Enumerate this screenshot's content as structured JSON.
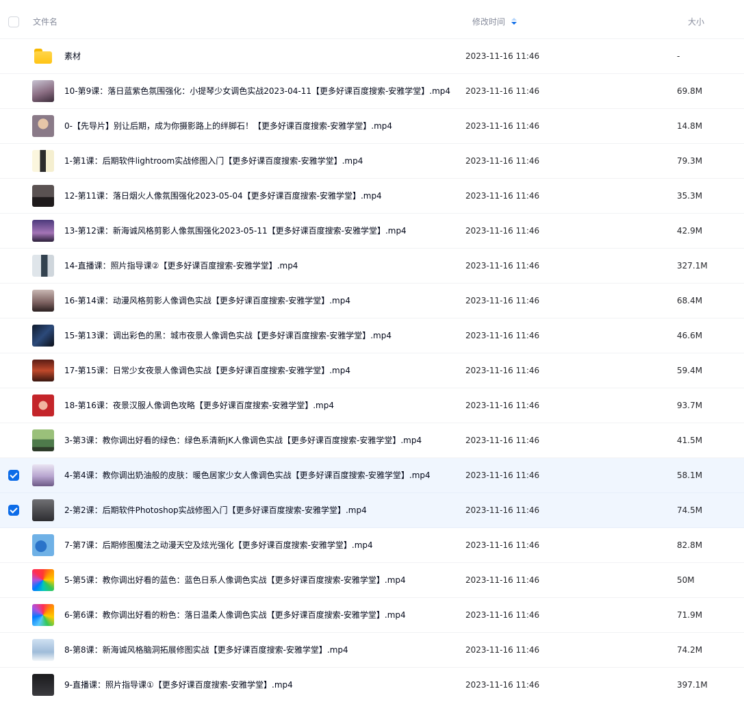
{
  "header": {
    "name_label": "文件名",
    "time_label": "修改时间",
    "size_label": "大小"
  },
  "files": [
    {
      "name": "素材",
      "time": "2023-11-16 11:46",
      "size": "-",
      "thumb": "folder-icon",
      "selected": false
    },
    {
      "name": "10-第9课：落日蓝紫色氛围强化：小提琴少女调色实战2023-04-11【更多好课百度搜索-安雅学堂】.mp4",
      "time": "2023-11-16 11:46",
      "size": "69.8M",
      "thumb": "video-thumbnail",
      "selected": false
    },
    {
      "name": "0-【先导片】别让后期，成为你摄影路上的绊脚石！【更多好课百度搜索-安雅学堂】.mp4",
      "time": "2023-11-16 11:46",
      "size": "14.8M",
      "thumb": "video-thumbnail",
      "selected": false
    },
    {
      "name": "1-第1课：后期软件lightroom实战修图入门【更多好课百度搜索-安雅学堂】.mp4",
      "time": "2023-11-16 11:46",
      "size": "79.3M",
      "thumb": "video-thumbnail",
      "selected": false
    },
    {
      "name": "12-第11课：落日烟火人像氛围强化2023-05-04【更多好课百度搜索-安雅学堂】.mp4",
      "time": "2023-11-16 11:46",
      "size": "35.3M",
      "thumb": "video-thumbnail",
      "selected": false
    },
    {
      "name": "13-第12课：新海诚风格剪影人像氛围强化2023-05-11【更多好课百度搜索-安雅学堂】.mp4",
      "time": "2023-11-16 11:46",
      "size": "42.9M",
      "thumb": "video-thumbnail",
      "selected": false
    },
    {
      "name": "14-直播课：照片指导课②【更多好课百度搜索-安雅学堂】.mp4",
      "time": "2023-11-16 11:46",
      "size": "327.1M",
      "thumb": "video-thumbnail",
      "selected": false
    },
    {
      "name": "16-第14课：动漫风格剪影人像调色实战【更多好课百度搜索-安雅学堂】.mp4",
      "time": "2023-11-16 11:46",
      "size": "68.4M",
      "thumb": "video-thumbnail",
      "selected": false
    },
    {
      "name": "15-第13课：调出彩色的黑：城市夜景人像调色实战【更多好课百度搜索-安雅学堂】.mp4",
      "time": "2023-11-16 11:46",
      "size": "46.6M",
      "thumb": "video-thumbnail",
      "selected": false
    },
    {
      "name": "17-第15课：日常少女夜景人像调色实战【更多好课百度搜索-安雅学堂】.mp4",
      "time": "2023-11-16 11:46",
      "size": "59.4M",
      "thumb": "video-thumbnail",
      "selected": false
    },
    {
      "name": "18-第16课：夜景汉服人像调色攻略【更多好课百度搜索-安雅学堂】.mp4",
      "time": "2023-11-16 11:46",
      "size": "93.7M",
      "thumb": "video-thumbnail",
      "selected": false
    },
    {
      "name": "3-第3课：教你调出好看的绿色：绿色系清新JK人像调色实战【更多好课百度搜索-安雅学堂】.mp4",
      "time": "2023-11-16 11:46",
      "size": "41.5M",
      "thumb": "video-thumbnail",
      "selected": false
    },
    {
      "name": "4-第4课：教你调出奶油般的皮肤：暖色居家少女人像调色实战【更多好课百度搜索-安雅学堂】.mp4",
      "time": "2023-11-16 11:46",
      "size": "58.1M",
      "thumb": "video-thumbnail",
      "selected": true
    },
    {
      "name": "2-第2课：后期软件Photoshop实战修图入门【更多好课百度搜索-安雅学堂】.mp4",
      "time": "2023-11-16 11:46",
      "size": "74.5M",
      "thumb": "video-thumbnail",
      "selected": true
    },
    {
      "name": "7-第7课：后期修图魔法之动漫天空及炫光强化【更多好课百度搜索-安雅学堂】.mp4",
      "time": "2023-11-16 11:46",
      "size": "82.8M",
      "thumb": "video-thumbnail",
      "selected": false
    },
    {
      "name": "5-第5课：教你调出好看的蓝色：蓝色日系人像调色实战【更多好课百度搜索-安雅学堂】.mp4",
      "time": "2023-11-16 11:46",
      "size": "50M",
      "thumb": "video-thumbnail",
      "selected": false
    },
    {
      "name": "6-第6课：教你调出好看的粉色：落日温柔人像调色实战【更多好课百度搜索-安雅学堂】.mp4",
      "time": "2023-11-16 11:46",
      "size": "71.9M",
      "thumb": "video-thumbnail",
      "selected": false
    },
    {
      "name": "8-第8课：新海诚风格脑洞拓展修图实战【更多好课百度搜索-安雅学堂】.mp4",
      "time": "2023-11-16 11:46",
      "size": "74.2M",
      "thumb": "video-thumbnail",
      "selected": false
    },
    {
      "name": "9-直播课：照片指导课①【更多好课百度搜索-安雅学堂】.mp4",
      "time": "2023-11-16 11:46",
      "size": "397.1M",
      "thumb": "video-thumbnail",
      "selected": false
    }
  ],
  "colors": {
    "accent": "#0d6ce8",
    "selected_row": "#f0f6fe",
    "folder": "#ffc414"
  }
}
